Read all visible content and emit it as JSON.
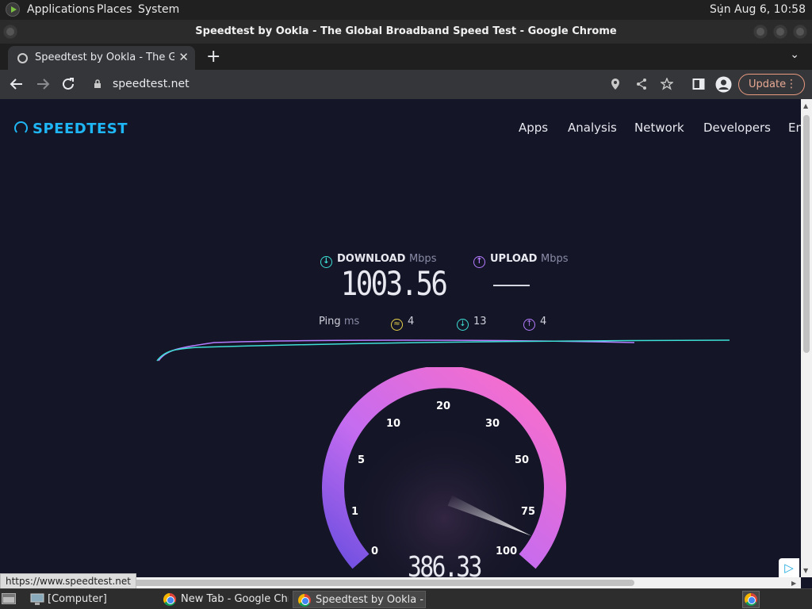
{
  "panel": {
    "applications": "Applications",
    "places": "Places",
    "system": "System",
    "clock": "Sun Aug  6, 10:58"
  },
  "window": {
    "title": "Speedtest by Ookla - The Global Broadband Speed Test - Google Chrome"
  },
  "tabs": {
    "active_label": "Speedtest by Ookla - The Global Broadband Speed Test",
    "new_tab": "+",
    "close": "✕",
    "list": "⌄"
  },
  "toolbar": {
    "url": "speedtest.net",
    "update_label": "Update",
    "menu": "⋮"
  },
  "site": {
    "logo": "SPEEDTEST",
    "nav": [
      "Apps",
      "Analysis",
      "Network",
      "Developers",
      "Enterprise"
    ]
  },
  "results": {
    "download_label": "DOWNLOAD",
    "download_unit": "Mbps",
    "download_value": "1003.56",
    "upload_label": "UPLOAD",
    "upload_unit": "Mbps",
    "ping_label": "Ping",
    "ping_unit": "ms",
    "ping_idle": "4",
    "ping_download": "13",
    "ping_upload": "4"
  },
  "gauge": {
    "ticks": [
      "0",
      "1",
      "5",
      "10",
      "20",
      "30",
      "50",
      "75",
      "100"
    ],
    "current_value": "386.33",
    "needle_level": 0.92
  },
  "status_link": "https://www.speedtest.net",
  "taskbar": {
    "items": [
      "[Computer]",
      "New Tab - Google Chrome",
      "Speedtest by Ookla - The Global Broadband Speed Test - Google Chrome"
    ]
  },
  "colors": {
    "download_accent": "#3ee0d6",
    "upload_accent": "#b47cff",
    "ping_accent": "#e8d24a",
    "gauge_start": "#7a4ce8",
    "gauge_end": "#ff6ec7",
    "logo": "#1fb6f5"
  }
}
